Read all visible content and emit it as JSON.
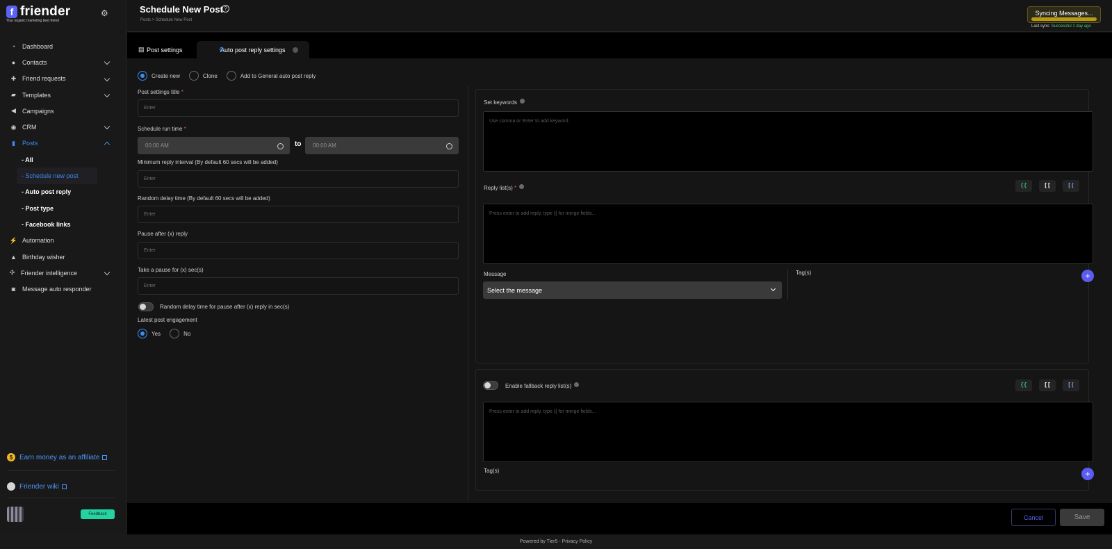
{
  "app": {
    "name": "friender",
    "logo_letter": "f",
    "tagline": "Your organic marketing best friend"
  },
  "sidebar": {
    "items": [
      {
        "label": "Dashboard"
      },
      {
        "label": "Contacts"
      },
      {
        "label": "Friend requests"
      },
      {
        "label": "Templates"
      },
      {
        "label": "Campaigns"
      },
      {
        "label": "CRM"
      },
      {
        "label": "Posts"
      },
      {
        "label": "Automation"
      },
      {
        "label": "Birthday wisher"
      },
      {
        "label": "Friender intelligence"
      },
      {
        "label": "Message auto responder"
      }
    ],
    "posts_sub": [
      {
        "label": "- All"
      },
      {
        "label": "- Schedule new post"
      },
      {
        "label": "- Auto post reply"
      },
      {
        "label": "- Post type"
      },
      {
        "label": "- Facebook links"
      }
    ],
    "affiliate": "Earn money as an affiliate",
    "wiki": "Friender wiki",
    "feedback": "Feedback"
  },
  "header": {
    "title": "Schedule New Post",
    "breadcrumb": "Posts   >   Schedule New Post",
    "sync_button": "Syncing Messages...",
    "last_sync_label": "Last sync:",
    "last_sync_value": "Successful 1 day ago"
  },
  "tabs": [
    {
      "label": "Post settings"
    },
    {
      "label": "Auto post reply settings"
    }
  ],
  "form": {
    "mode_options": [
      "Create new",
      "Clone",
      "Add to General auto post reply"
    ],
    "post_settings_title_label": "Post settings title",
    "required_mark": "*",
    "placeholder": "Enter",
    "schedule_run_time_label": "Schedule run time",
    "time_start": "00:00 AM",
    "time_end": "00:00 AM",
    "to": "to",
    "min_reply_interval_label": "Minimum reply interval (By default 60 secs will be added)",
    "random_delay_label": "Random delay time (By default 60 secs will be added)",
    "pause_after_label": "Pause after (x) reply",
    "take_pause_label": "Take a pause for (x) sec(s)",
    "random_delay_toggle_label": "Random delay time for pause after (x) reply in sec(s)",
    "latest_engagement_label": "Latest post engagement",
    "yes": "Yes",
    "no": "No"
  },
  "right": {
    "keywords_label": "Set keywords",
    "keywords_placeholder": "Use comma or Enter to add keyword",
    "reply_list_label": "Reply list(s)",
    "reply_placeholder": "Press enter to add reply, type {{ for merge fields...",
    "chip_1": "{{",
    "chip_2": "[[",
    "chip_3": "[(",
    "message_label": "Message",
    "select_message": "Select the message",
    "tags_label": "Tag(s)",
    "plus": "+",
    "fallback_label": "Enable fallback reply list(s)"
  },
  "actions": {
    "cancel": "Cancel",
    "save": "Save"
  },
  "footer": {
    "powered": "Powered by Tier5 - Privacy Policy"
  },
  "colors": {
    "accent": "#3d8bf2",
    "brand": "#5b62f2",
    "feedback": "#24d3a1",
    "sync": "#b89a10"
  }
}
